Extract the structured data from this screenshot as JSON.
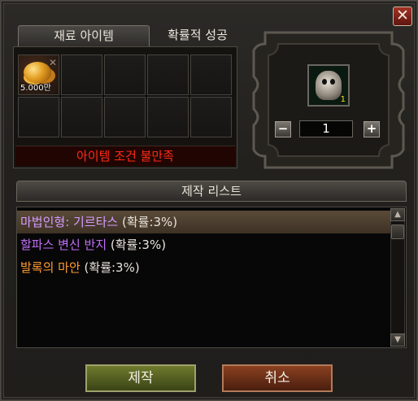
{
  "window": {
    "close_label": "✕",
    "tabs": [
      {
        "label": "재료 아이템",
        "active": true
      },
      {
        "label": "확률적 성공",
        "active": false
      }
    ]
  },
  "materials": {
    "slots": [
      {
        "icon": "gold-coins-icon",
        "quantity": "5.000만"
      },
      {},
      {},
      {},
      {},
      {},
      {},
      {},
      {},
      {}
    ],
    "condition_text": "아이템 조건 불만족"
  },
  "result": {
    "icon": "ghost-doll-icon",
    "count": "1",
    "quantity_value": "1",
    "minus_label": "−",
    "plus_label": "+"
  },
  "craft_list": {
    "header": "제작 리스트",
    "items": [
      {
        "name": "마법인형: 기르타스",
        "rate": " (확률:3%)",
        "selected": true
      },
      {
        "name": "할파스 변신 반지",
        "rate": " (확률:3%)",
        "selected": false
      },
      {
        "name": "발록의 마안",
        "rate": " (확률:3%)",
        "selected": false
      }
    ],
    "scroll_up": "▲",
    "scroll_down": "▼"
  },
  "buttons": {
    "craft": "제작",
    "cancel": "취소"
  },
  "colors": {
    "condition_text": "#ff2a14",
    "item1": "#d69bff",
    "item2": "#c16ef5",
    "item3": "#ff9a2e",
    "craft_button": "#6f7a2c",
    "cancel_button": "#8a4020"
  }
}
